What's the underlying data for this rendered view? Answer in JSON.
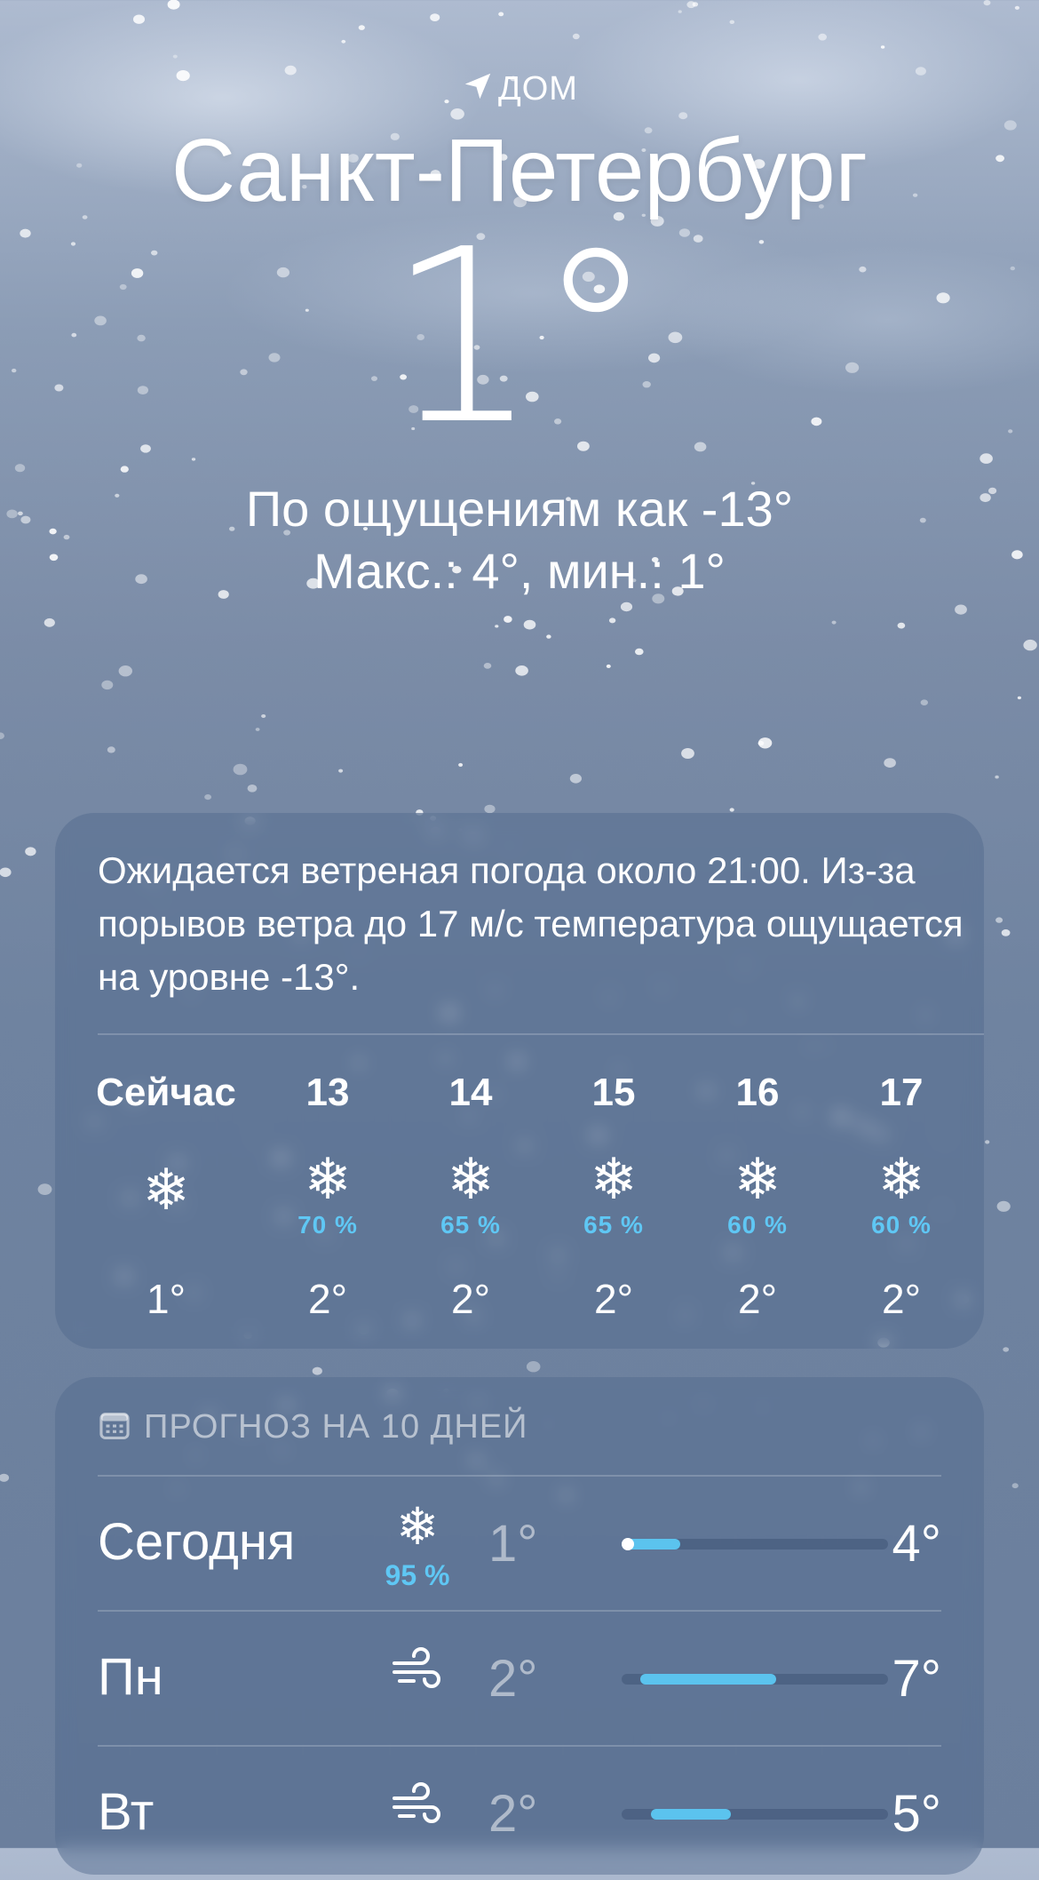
{
  "header": {
    "location_label": "дом",
    "city": "Санкт-Петербург",
    "temperature": "1°",
    "feels_like": "По ощущениям как -13°",
    "high_low": "Макс.: 4°, мин.: 1°"
  },
  "hourly": {
    "summary": "Ожидается ветреная погода около 21:00. Из-за порывов ветра до 17 м/с температура ощущается на уровне -13°.",
    "items": [
      {
        "time": "Сейчас",
        "icon": "snowflake-icon",
        "precip": "",
        "temp": "1°"
      },
      {
        "time": "13",
        "icon": "snowflake-icon",
        "precip": "70 %",
        "temp": "2°"
      },
      {
        "time": "14",
        "icon": "snowflake-icon",
        "precip": "65 %",
        "temp": "2°"
      },
      {
        "time": "15",
        "icon": "snowflake-icon",
        "precip": "65 %",
        "temp": "2°"
      },
      {
        "time": "16",
        "icon": "snowflake-icon",
        "precip": "60 %",
        "temp": "2°"
      },
      {
        "time": "17",
        "icon": "snowflake-icon",
        "precip": "60 %",
        "temp": "2°"
      }
    ]
  },
  "daily": {
    "title": "Прогноз на 10 дней",
    "days": [
      {
        "day": "Сегодня",
        "icon": "snowflake-icon",
        "precip": "95 %",
        "min": "1°",
        "max": "4°",
        "range_start": 0.0,
        "range_end": 0.22,
        "current": 0.0
      },
      {
        "day": "Пн",
        "icon": "wind-icon",
        "precip": "",
        "min": "2°",
        "max": "7°",
        "range_start": 0.07,
        "range_end": 0.58
      },
      {
        "day": "Вт",
        "icon": "wind-icon",
        "precip": "",
        "min": "2°",
        "max": "5°",
        "range_start": 0.11,
        "range_end": 0.41
      }
    ]
  },
  "colors": {
    "accent_precip": "#5fc7f4",
    "bar_fill": "#5bc3ee",
    "card_bg": "rgba(80,105,140,0.45)"
  }
}
